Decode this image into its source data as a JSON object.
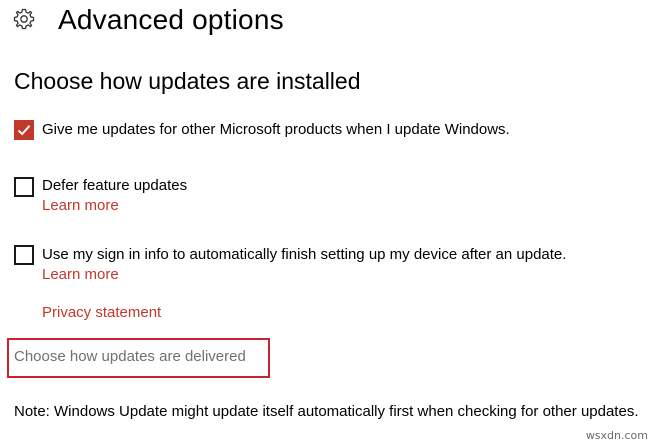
{
  "header": {
    "title": "Advanced options",
    "icon": "gear-icon"
  },
  "section": {
    "title": "Choose how updates are installed"
  },
  "options": [
    {
      "label": "Give me updates for other Microsoft products when I update Windows.",
      "checked": true
    },
    {
      "label": "Defer feature updates",
      "checked": false,
      "link": "Learn more"
    },
    {
      "label": "Use my sign in info to automatically finish setting up my device after an update.",
      "checked": false,
      "link": "Learn more"
    }
  ],
  "privacy_link": "Privacy statement",
  "delivery_link": "Choose how updates are delivered",
  "note": "Note: Windows Update might update itself automatically first when checking for other updates.",
  "watermark": "wsxdn.com",
  "colors": {
    "accent": "#c0392b",
    "highlight_box": "#c8242e",
    "muted_link": "#707070"
  }
}
